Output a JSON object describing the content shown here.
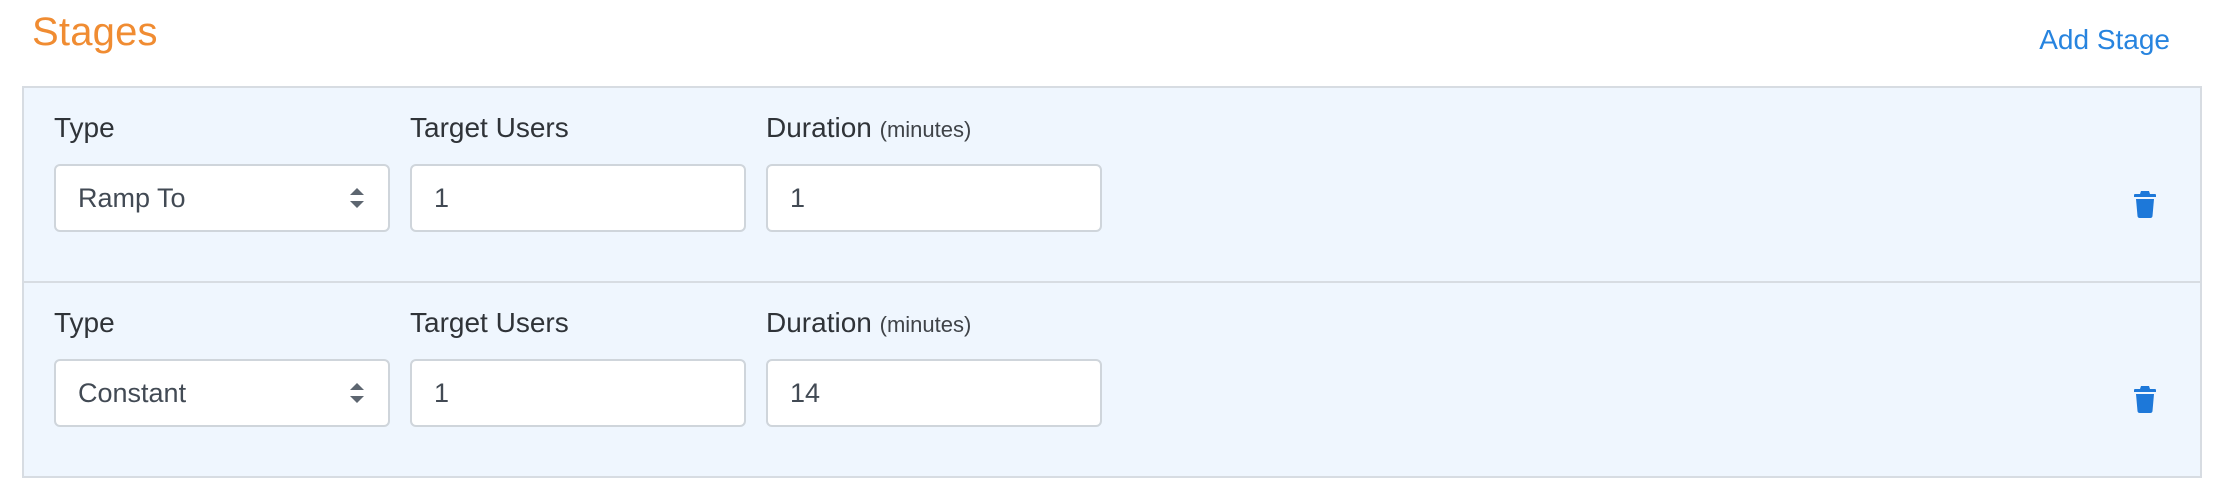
{
  "header": {
    "title": "Stages",
    "add_stage_label": "Add Stage"
  },
  "stages": [
    {
      "type_label": "Type",
      "type_value": "Ramp To",
      "users_label": "Target Users",
      "users_value": "1",
      "duration_label": "Duration",
      "duration_unit": "(minutes)",
      "duration_value": "1"
    },
    {
      "type_label": "Type",
      "type_value": "Constant",
      "users_label": "Target Users",
      "users_value": "1",
      "duration_label": "Duration",
      "duration_unit": "(minutes)",
      "duration_value": "14"
    }
  ],
  "icons": {
    "select_arrows": "sort-icon",
    "delete": "trash-icon"
  },
  "colors": {
    "title": "#f08c32",
    "link": "#2784df",
    "panel_background": "#eff6fe",
    "border": "#d7dce2",
    "trash": "#1d78d9"
  }
}
